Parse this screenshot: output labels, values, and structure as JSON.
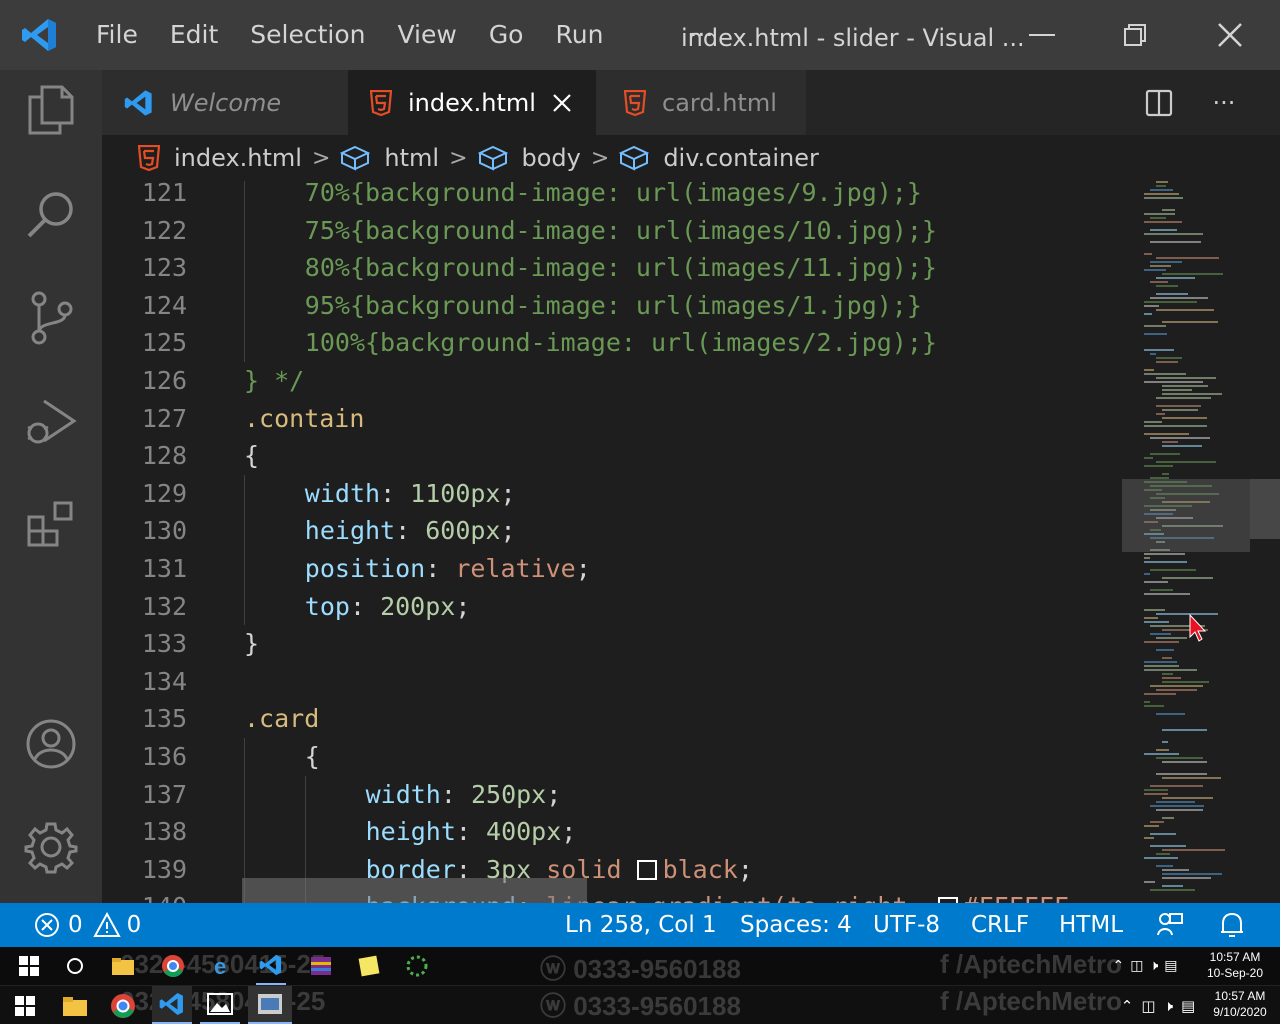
{
  "app": {
    "title": "index.html - slider - Visual ...",
    "menu": [
      "File",
      "Edit",
      "Selection",
      "View",
      "Go",
      "Run",
      "···"
    ]
  },
  "tabs": [
    {
      "label": "Welcome",
      "icon": "vscode-logo-icon",
      "active": false
    },
    {
      "label": "index.html",
      "icon": "html5-icon",
      "active": true
    },
    {
      "label": "card.html",
      "icon": "html5-icon",
      "active": false
    }
  ],
  "tab_actions": {
    "more": "···"
  },
  "breadcrumb": {
    "file": "index.html",
    "sep": ">",
    "items": [
      "html",
      "body",
      "div.container"
    ]
  },
  "editor": {
    "lines": [
      {
        "n": "121",
        "indent": 1,
        "tokens": [
          [
            "comment",
            "70%{background-image: url(images/9.jpg);}"
          ]
        ]
      },
      {
        "n": "122",
        "indent": 1,
        "tokens": [
          [
            "comment",
            "75%{background-image: url(images/10.jpg);}"
          ]
        ]
      },
      {
        "n": "123",
        "indent": 1,
        "tokens": [
          [
            "comment",
            "80%{background-image: url(images/11.jpg);}"
          ]
        ]
      },
      {
        "n": "124",
        "indent": 1,
        "tokens": [
          [
            "comment",
            "95%{background-image: url(images/1.jpg);}"
          ]
        ]
      },
      {
        "n": "125",
        "indent": 1,
        "tokens": [
          [
            "comment",
            "100%{background-image: url(images/2.jpg);}"
          ]
        ]
      },
      {
        "n": "126",
        "indent": 0,
        "tokens": [
          [
            "comment",
            "} */"
          ]
        ]
      },
      {
        "n": "127",
        "indent": 0,
        "tokens": [
          [
            "sel",
            ".contain"
          ]
        ]
      },
      {
        "n": "128",
        "indent": 0,
        "tokens": [
          [
            "punct",
            "{"
          ]
        ]
      },
      {
        "n": "129",
        "indent": 1,
        "tokens": [
          [
            "prop",
            "width"
          ],
          [
            "punct",
            ": "
          ],
          [
            "num",
            "1100px"
          ],
          [
            "punct",
            ";"
          ]
        ]
      },
      {
        "n": "130",
        "indent": 1,
        "tokens": [
          [
            "prop",
            "height"
          ],
          [
            "punct",
            ": "
          ],
          [
            "num",
            "600px"
          ],
          [
            "punct",
            ";"
          ]
        ]
      },
      {
        "n": "131",
        "indent": 1,
        "tokens": [
          [
            "prop",
            "position"
          ],
          [
            "punct",
            ": "
          ],
          [
            "val",
            "relative"
          ],
          [
            "punct",
            ";"
          ]
        ]
      },
      {
        "n": "132",
        "indent": 1,
        "tokens": [
          [
            "prop",
            "top"
          ],
          [
            "punct",
            ": "
          ],
          [
            "num",
            "200px"
          ],
          [
            "punct",
            ";"
          ]
        ]
      },
      {
        "n": "133",
        "indent": 0,
        "tokens": [
          [
            "punct",
            "}"
          ]
        ]
      },
      {
        "n": "134",
        "indent": 0,
        "tokens": []
      },
      {
        "n": "135",
        "indent": 0,
        "tokens": [
          [
            "sel",
            ".card"
          ]
        ]
      },
      {
        "n": "136",
        "indent": 1,
        "tokens": [
          [
            "punct",
            "{"
          ]
        ]
      },
      {
        "n": "137",
        "indent": 2,
        "tokens": [
          [
            "prop",
            "width"
          ],
          [
            "punct",
            ": "
          ],
          [
            "num",
            "250px"
          ],
          [
            "punct",
            ";"
          ]
        ]
      },
      {
        "n": "138",
        "indent": 2,
        "tokens": [
          [
            "prop",
            "height"
          ],
          [
            "punct",
            ": "
          ],
          [
            "num",
            "400px"
          ],
          [
            "punct",
            ";"
          ]
        ]
      },
      {
        "n": "139",
        "indent": 2,
        "tokens": [
          [
            "prop",
            "border"
          ],
          [
            "punct",
            ": "
          ],
          [
            "num",
            "3px"
          ],
          [
            "punct",
            " "
          ],
          [
            "val",
            "solid"
          ],
          [
            "punct",
            " "
          ],
          [
            "swatch",
            ""
          ],
          [
            "val",
            "black"
          ],
          [
            "punct",
            ";"
          ]
        ]
      },
      {
        "n": "140",
        "indent": 2,
        "tokens": [
          [
            "prop",
            "background"
          ],
          [
            "punct",
            ": "
          ],
          [
            "val",
            "linear-gradient(to right, "
          ],
          [
            "swatch",
            ""
          ],
          [
            "val",
            "#FFFFFF"
          ]
        ]
      }
    ]
  },
  "status": {
    "errors": "0",
    "warnings": "0",
    "position": "Ln 258, Col 1",
    "spaces": "Spaces: 4",
    "encoding": "UTF-8",
    "eol": "CRLF",
    "language": "HTML"
  },
  "taskbar": {
    "clock1_time": "10:57 AM",
    "clock1_date": "10-Sep-20",
    "clock2_time": "10:57 AM",
    "clock2_date": "9/10/2020"
  },
  "watermark": {
    "phone1": "0321-4580415-25",
    "phone2": "ⓦ 0333-9560188",
    "social": "f /AptechMetro"
  },
  "colors": {
    "accent": "#007acc",
    "titlebar": "#3c3c3c",
    "activitybar": "#333333",
    "editor_bg": "#1e1e1e",
    "html_icon": "#e44d26"
  }
}
